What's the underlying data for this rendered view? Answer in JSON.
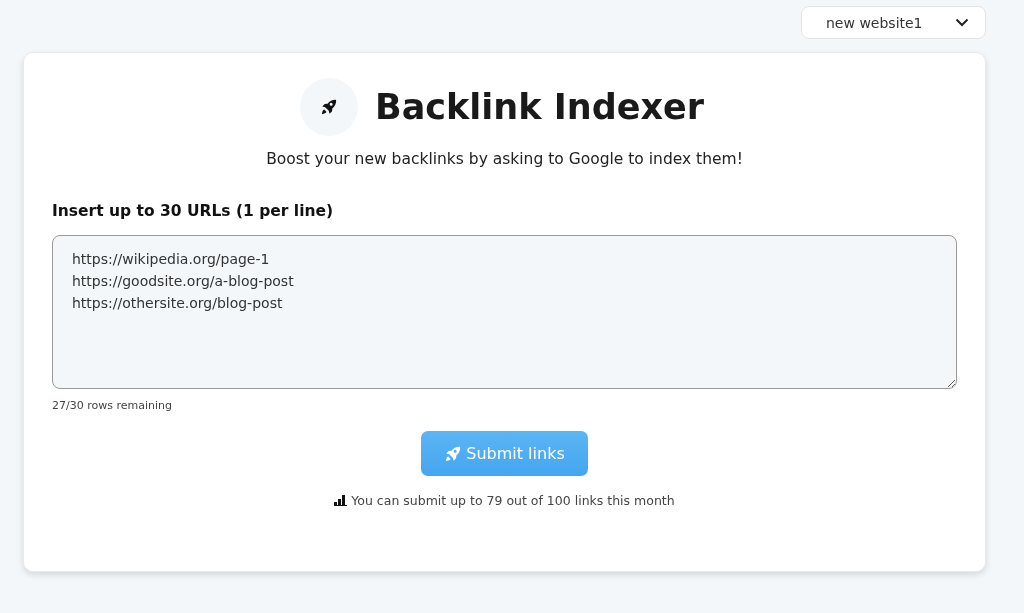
{
  "site_select": {
    "value": "new website1"
  },
  "header": {
    "title": "Backlink Indexer",
    "subtitle": "Boost your new backlinks by asking to Google to index them!"
  },
  "url_input": {
    "label": "Insert up to 30 URLs (1 per line)",
    "value": "https://wikipedia.org/page-1\nhttps://goodsite.org/a-blog-post\nhttps://othersite.org/blog-post",
    "remaining": "27/30 rows remaining"
  },
  "submit_button": {
    "label": "Submit links"
  },
  "quota": "You can submit up to 79 out of 100 links this month"
}
